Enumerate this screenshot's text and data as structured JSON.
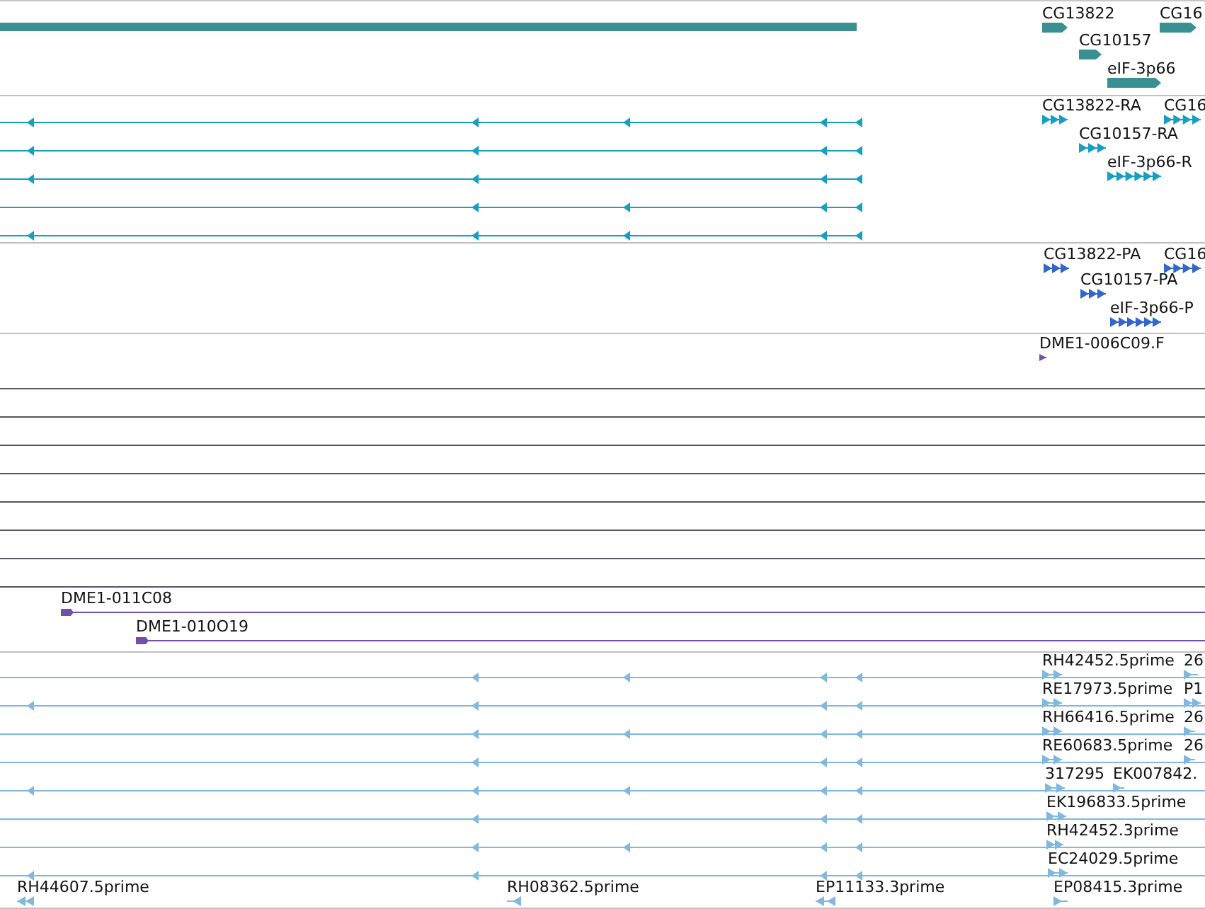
{
  "tracks": [
    {
      "kind": "gene",
      "color": "#3a9090",
      "features": [
        {
          "label": "CG13822"
        },
        {
          "label": "CG16"
        },
        {
          "label": "CG10157"
        },
        {
          "label": "eIF-3p66"
        }
      ]
    },
    {
      "kind": "transcript",
      "color": "#159fc0",
      "features": [
        {
          "label": "CG13822-RA"
        },
        {
          "label": "CG16"
        },
        {
          "label": "CG10157-RA"
        },
        {
          "label": "eIF-3p66-R"
        }
      ]
    },
    {
      "kind": "protein",
      "color": "#3366cc",
      "features": [
        {
          "label": "CG13822-PA"
        },
        {
          "label": "CG16"
        },
        {
          "label": "CG10157-PA"
        },
        {
          "label": "eIF-3p66-P"
        }
      ]
    },
    {
      "kind": "clone",
      "color": "#7050a8",
      "features": [
        {
          "label": "DME1-006C09.F"
        },
        {
          "label": "DME1-011C08"
        },
        {
          "label": "DME1-010O19"
        }
      ]
    },
    {
      "kind": "est",
      "color": "#80b8de",
      "features": [
        {
          "label": "RH42452.5prime"
        },
        {
          "label": "26"
        },
        {
          "label": "RE17973.5prime"
        },
        {
          "label": "P1"
        },
        {
          "label": "RH66416.5prime"
        },
        {
          "label": "26"
        },
        {
          "label": "RE60683.5prime"
        },
        {
          "label": "26"
        },
        {
          "label": "317295"
        },
        {
          "label": "EK007842."
        },
        {
          "label": "EK196833.5prime"
        },
        {
          "label": "RH42452.3prime"
        },
        {
          "label": "EC24029.5prime"
        },
        {
          "label": "RH44607.5prime"
        },
        {
          "label": "RH08362.5prime"
        },
        {
          "label": "EP11133.3prime"
        },
        {
          "label": "EP08415.3prime"
        }
      ]
    }
  ]
}
